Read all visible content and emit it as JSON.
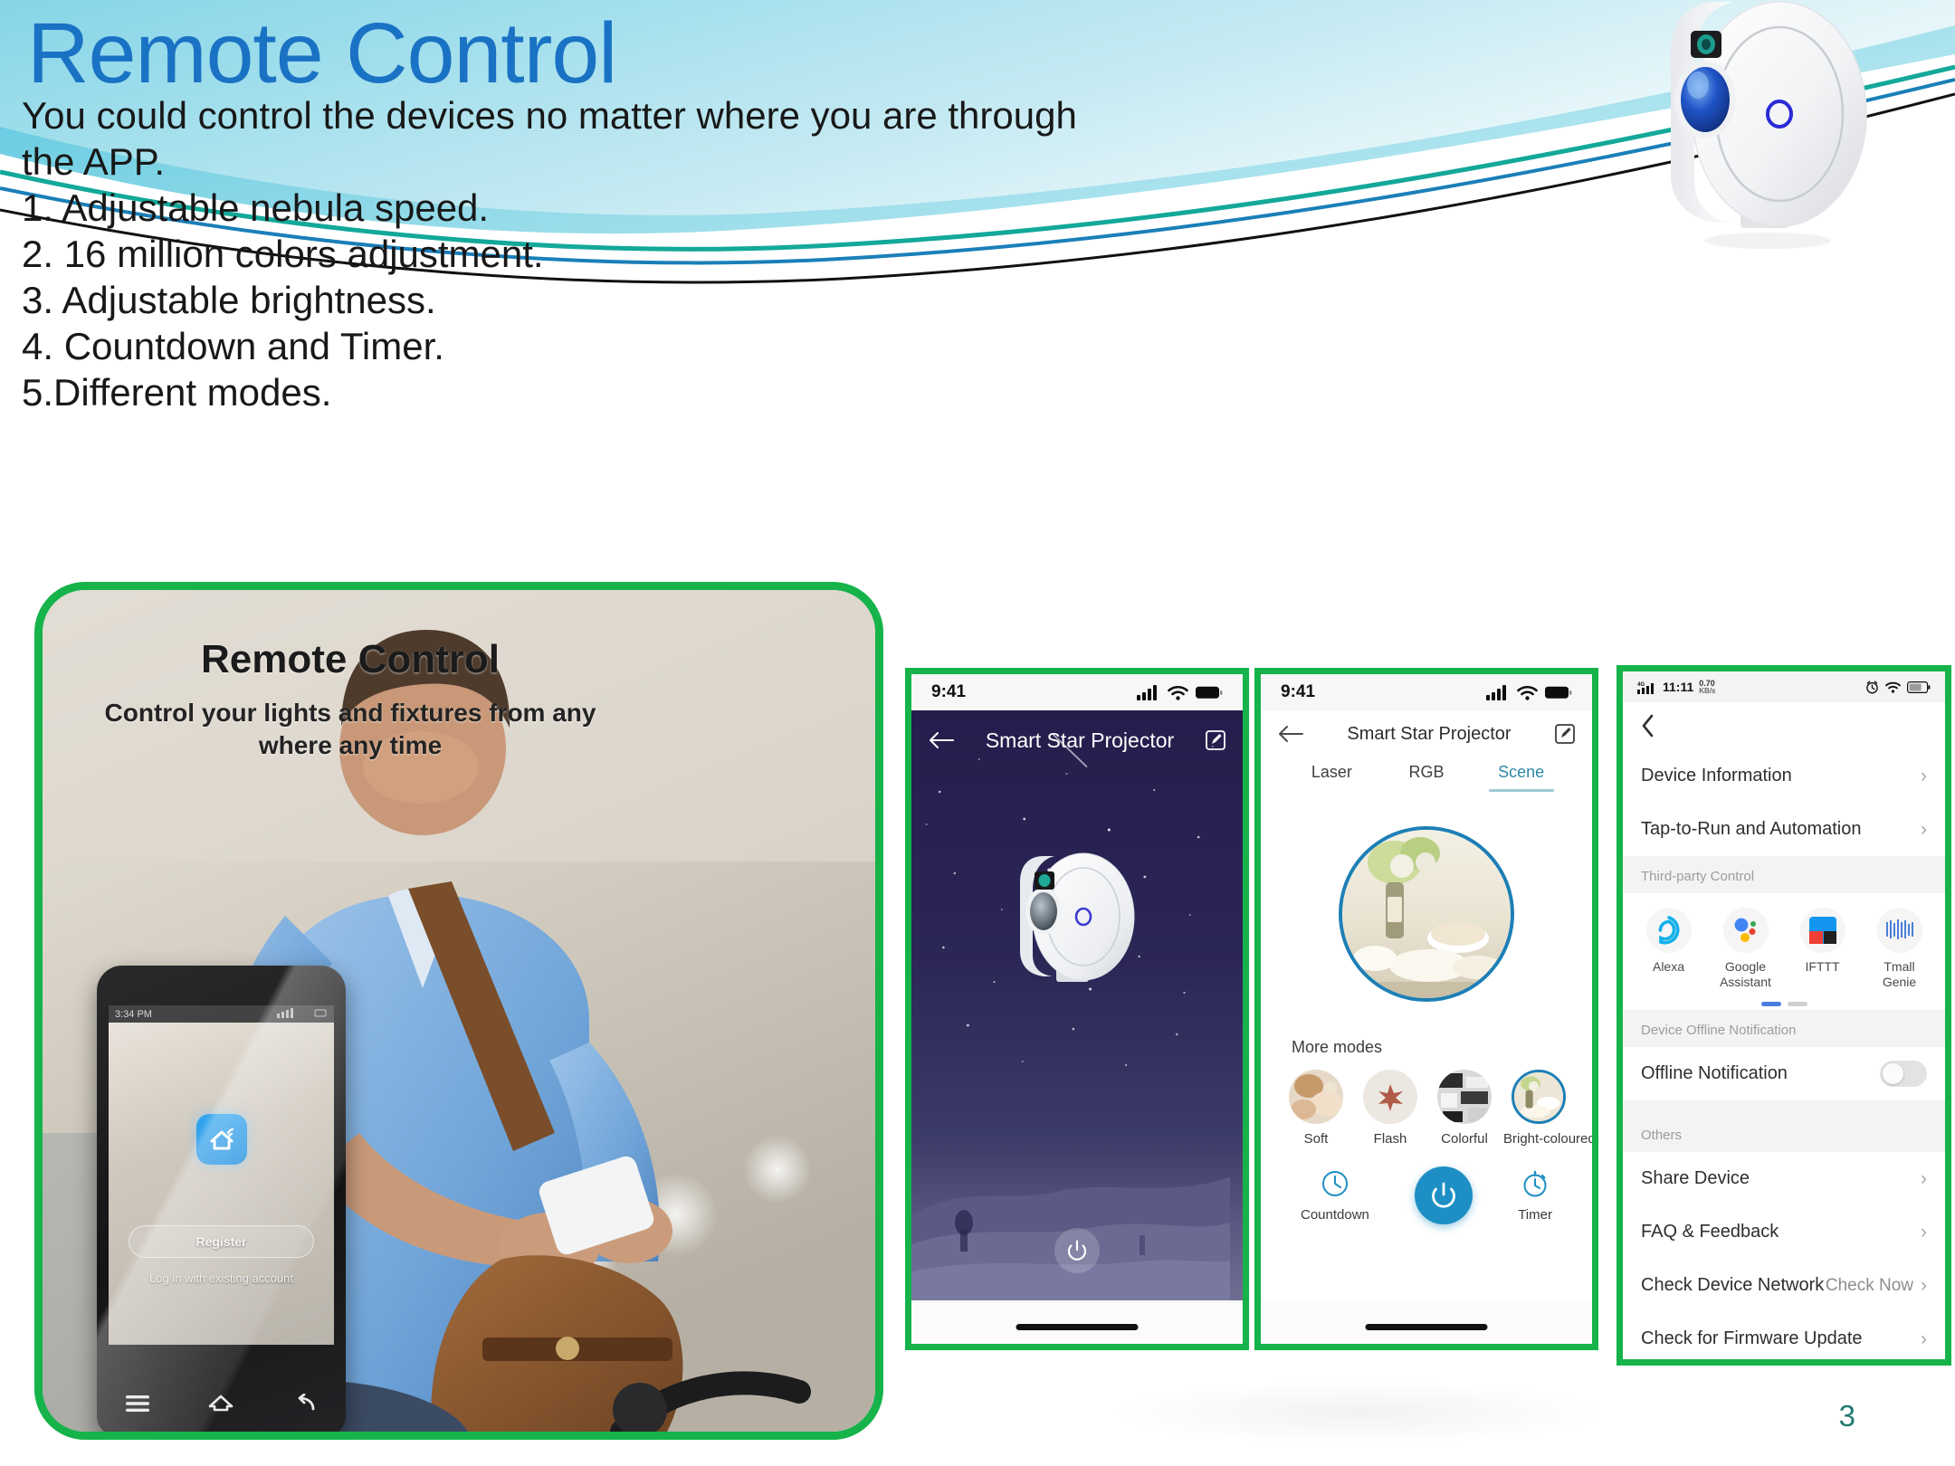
{
  "slide": {
    "title": "Remote Control",
    "page_number": "3",
    "body_lines": [
      "You could control the devices no matter where you are through",
      "the APP.",
      "1. Adjustable nebula speed.",
      "2. 16 million colors adjustment.",
      "3. Adjustable brightness.",
      "4. Countdown and Timer.",
      "5.Different modes."
    ]
  },
  "promo_card": {
    "title": "Remote Control",
    "subtitle": "Control your lights and fixtures from any where any time",
    "phone_mock": {
      "status_time": "3:34 PM",
      "register_label": "Register",
      "login_label": "Log in with existing account"
    }
  },
  "phone1": {
    "status_time": "9:41",
    "nav_title": "Smart Star Projector",
    "back_icon": "back-arrow-icon",
    "edit_icon": "edit-pencil-icon",
    "power_icon": "power-icon"
  },
  "phone2": {
    "status_time": "9:41",
    "nav_title": "Smart Star Projector",
    "tabs": [
      {
        "label": "Laser",
        "active": false
      },
      {
        "label": "RGB",
        "active": false
      },
      {
        "label": "Scene",
        "active": true
      }
    ],
    "more_modes_label": "More modes",
    "modes": [
      {
        "label": "Soft",
        "selected": false
      },
      {
        "label": "Flash",
        "selected": false
      },
      {
        "label": "Colorful",
        "selected": false
      },
      {
        "label": "Bright-coloured",
        "selected": true
      }
    ],
    "countdown_label": "Countdown",
    "timer_label": "Timer",
    "accent_color": "#1d8fc4"
  },
  "phone3": {
    "status_time": "11:11",
    "status_network": "4G",
    "status_rate": "0.70",
    "status_rate_unit": "KB/s",
    "back_icon": "chevron-left-icon",
    "rows_top": [
      {
        "label": "Device Information"
      },
      {
        "label": "Tap-to-Run and Automation"
      }
    ],
    "third_party_heading": "Third-party Control",
    "third_party": [
      {
        "label": "Alexa",
        "icon": "alexa-icon"
      },
      {
        "label": "Google Assistant",
        "icon": "google-assistant-icon"
      },
      {
        "label": "IFTTT",
        "icon": "ifttt-icon"
      },
      {
        "label": "Tmall Genie",
        "icon": "tmall-genie-icon"
      }
    ],
    "offline_heading": "Device Offline Notification",
    "offline_row": {
      "label": "Offline Notification",
      "toggle_on": false
    },
    "others_heading": "Others",
    "rows_others": [
      {
        "label": "Share Device",
        "value": ""
      },
      {
        "label": "FAQ & Feedback",
        "value": ""
      },
      {
        "label": "Check Device Network",
        "value": "Check Now"
      },
      {
        "label": "Check for Firmware Update",
        "value": ""
      }
    ]
  },
  "colors": {
    "title_blue": "#1a72c4",
    "frame_green": "#15b34a",
    "swoosh_cyan": "#6fcfe0",
    "swoosh_teal": "#13a89a",
    "page_num": "#1f7a6e"
  }
}
